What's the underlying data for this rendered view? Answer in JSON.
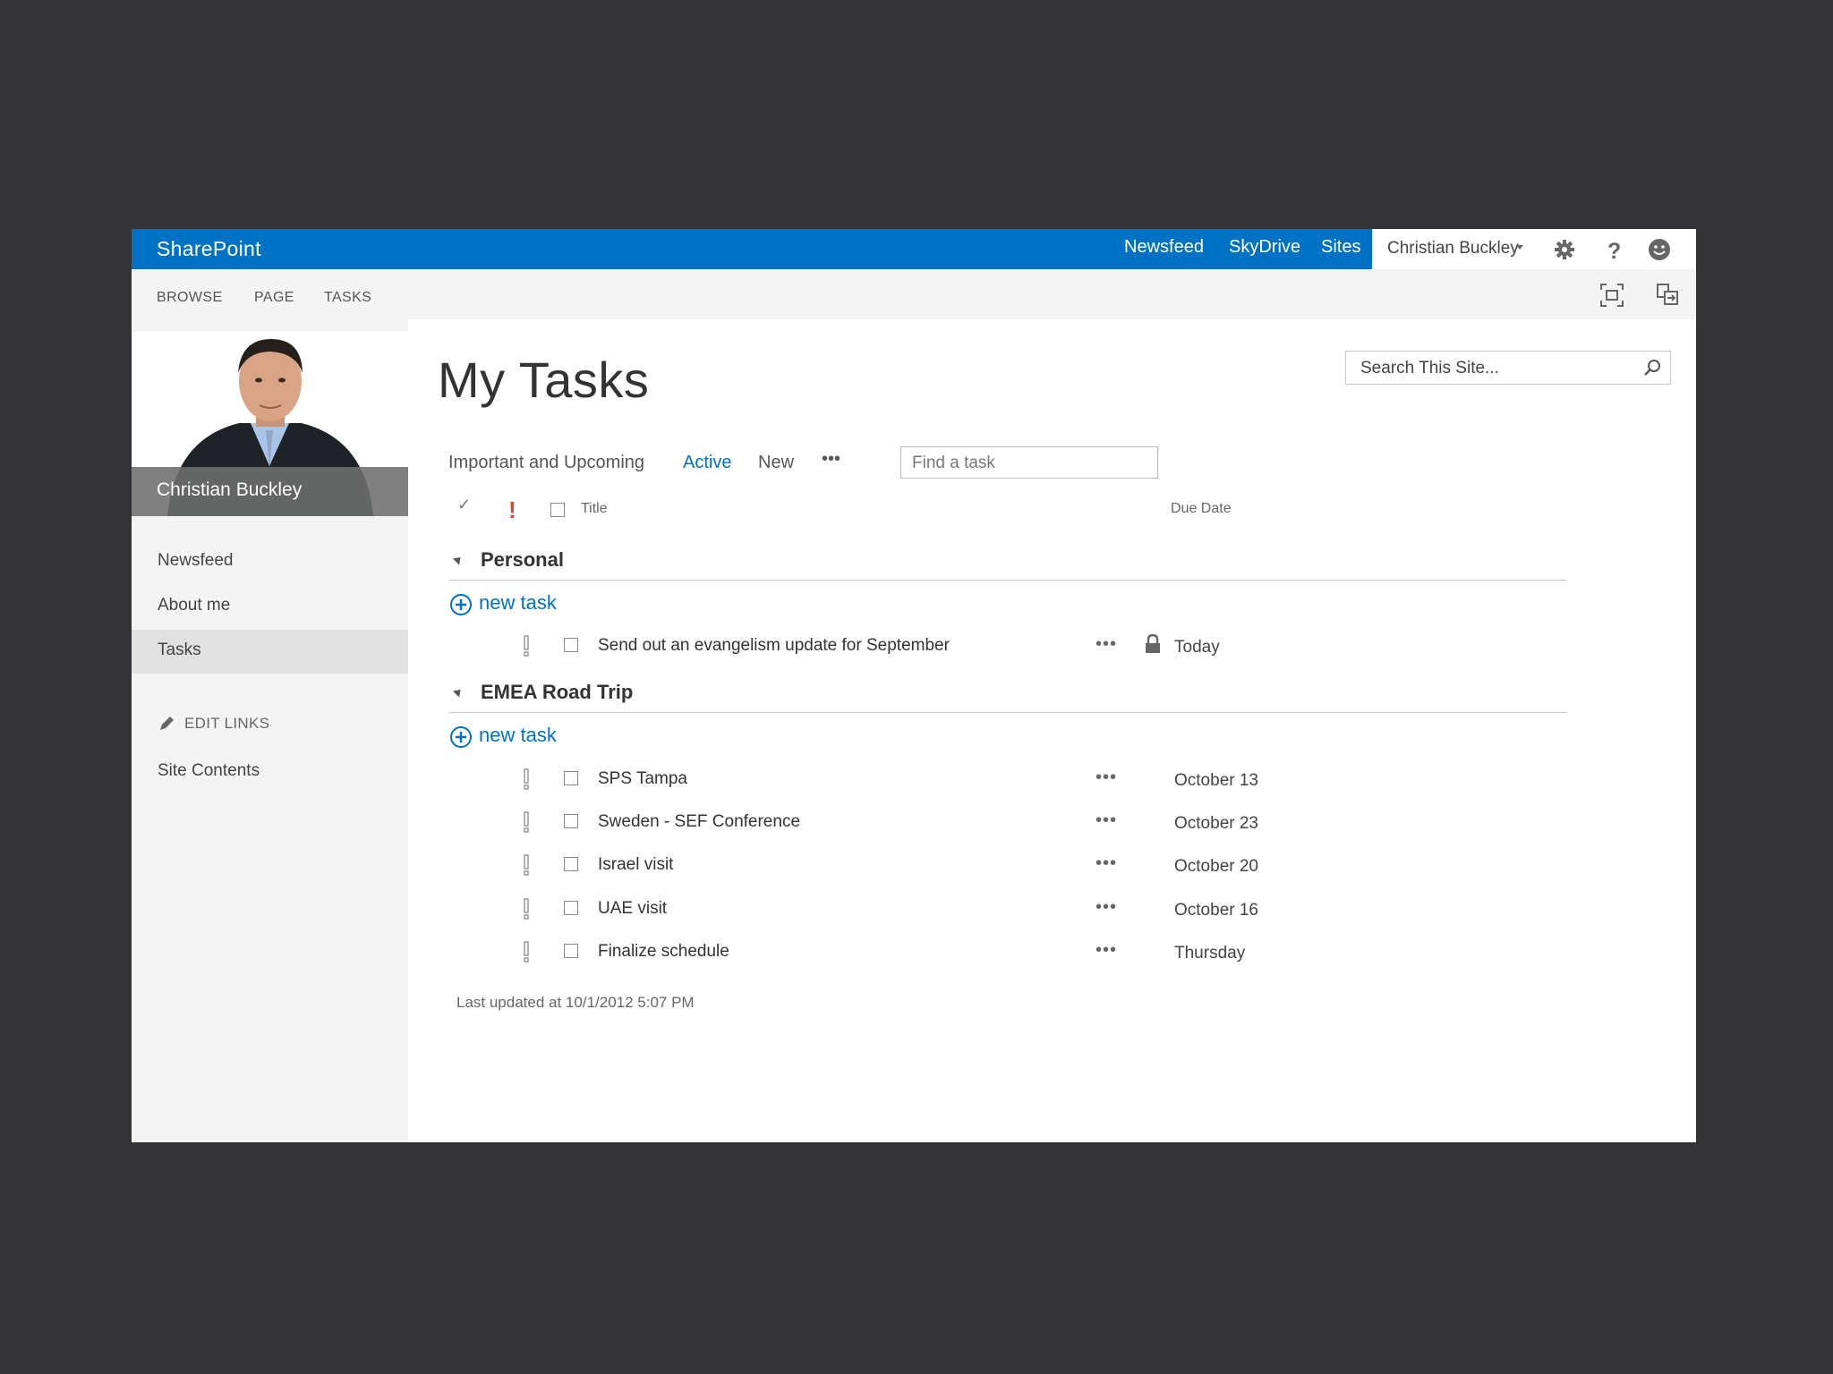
{
  "topbar": {
    "brand": "SharePoint",
    "links": [
      "Newsfeed",
      "SkyDrive",
      "Sites"
    ],
    "user_name": "Christian Buckley",
    "icons": [
      "gear-icon",
      "help-icon",
      "smiley-icon"
    ]
  },
  "ribbon": {
    "tabs": [
      "BROWSE",
      "PAGE",
      "TASKS"
    ],
    "icons": [
      "focus-icon",
      "share-icon"
    ]
  },
  "profile": {
    "name": "Christian Buckley"
  },
  "leftnav": {
    "items": [
      "Newsfeed",
      "About me",
      "Tasks"
    ],
    "selected": "Tasks",
    "edit_links": "EDIT LINKS",
    "site_contents": "Site Contents"
  },
  "page": {
    "title": "My Tasks",
    "site_search_placeholder": "Search This Site...",
    "views": [
      "Important and Upcoming",
      "Active",
      "New",
      "•••"
    ],
    "active_view": "Active",
    "task_search_placeholder": "Find a task",
    "columns": {
      "check": "✓",
      "importance": "!",
      "title": "Title",
      "due": "Due Date"
    }
  },
  "groups": [
    {
      "name": "Personal",
      "new_task_label": "new task",
      "tasks": [
        {
          "title": "Send out an evangelism update for September",
          "due": "Today",
          "locked": true
        }
      ]
    },
    {
      "name": "EMEA Road Trip",
      "new_task_label": "new task",
      "tasks": [
        {
          "title": "SPS Tampa",
          "due": "October 13",
          "locked": false
        },
        {
          "title": "Sweden - SEF Conference",
          "due": "October 23",
          "locked": false
        },
        {
          "title": "Israel visit",
          "due": "October 20",
          "locked": false
        },
        {
          "title": "UAE visit",
          "due": "October 16",
          "locked": false
        },
        {
          "title": "Finalize schedule",
          "due": "Thursday",
          "locked": false
        }
      ]
    }
  ],
  "footer": {
    "last_updated": "Last updated at 10/1/2012 5:07 PM"
  },
  "colors": {
    "brand_blue": "#0072c6",
    "importance_red": "#e8402b"
  }
}
